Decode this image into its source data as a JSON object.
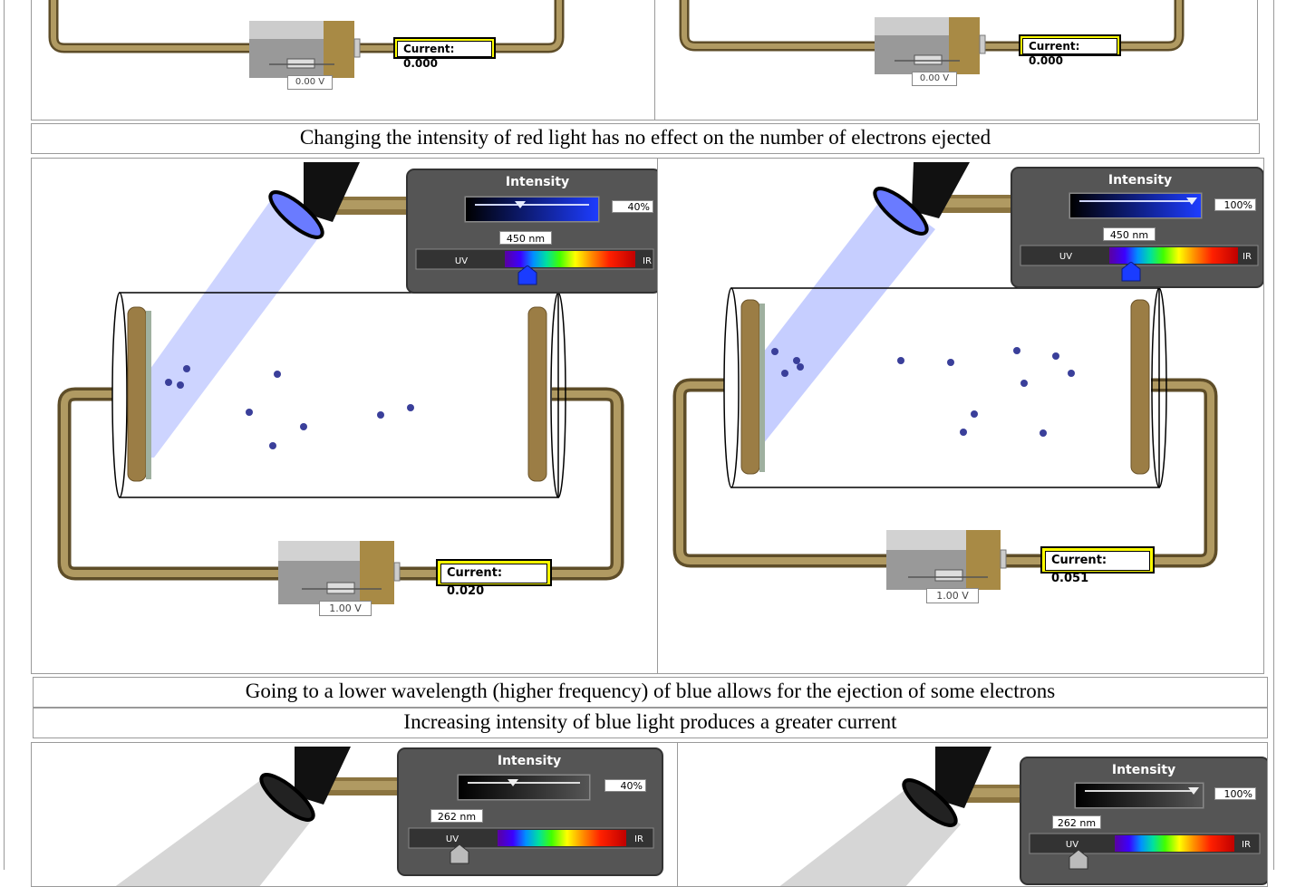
{
  "captions": {
    "red_intensity": "Changing the intensity of red light has no effect on the number of electrons ejected",
    "blue_wavelength": "Going to a lower wavelength (higher frequency) of blue allows for the ejection of some electrons",
    "blue_intensity": "Increasing intensity of blue light produces a greater current"
  },
  "row1": {
    "left": {
      "current_label": "Current:",
      "current_value": "0.000",
      "voltage": "0.00 V"
    },
    "right": {
      "current_label": "Current:",
      "current_value": "0.000",
      "voltage": "0.00 V"
    }
  },
  "row2": {
    "left": {
      "intensity_title": "Intensity",
      "intensity_pct": "40%",
      "intensity_level": 0.4,
      "wavelength": "450 nm",
      "uv_label": "UV",
      "ir_label": "IR",
      "current_label": "Current:",
      "current_value": "0.020",
      "voltage": "1.00 V",
      "beam_color": "#8f9cff"
    },
    "right": {
      "intensity_title": "Intensity",
      "intensity_pct": "100%",
      "intensity_level": 1.0,
      "wavelength": "450 nm",
      "uv_label": "UV",
      "ir_label": "IR",
      "current_label": "Current:",
      "current_value": "0.051",
      "voltage": "1.00 V",
      "beam_color": "#8f9cff"
    }
  },
  "row3": {
    "left": {
      "intensity_title": "Intensity",
      "intensity_pct": "40%",
      "intensity_level": 0.4,
      "wavelength": "262 nm",
      "uv_label": "UV",
      "ir_label": "IR"
    },
    "right": {
      "intensity_title": "Intensity",
      "intensity_pct": "100%",
      "intensity_level": 1.0,
      "wavelength": "262 nm",
      "uv_label": "UV",
      "ir_label": "IR"
    }
  },
  "colors": {
    "wire": "#8b7440",
    "highlight_box": "#ffff00",
    "panel": "#555555"
  }
}
